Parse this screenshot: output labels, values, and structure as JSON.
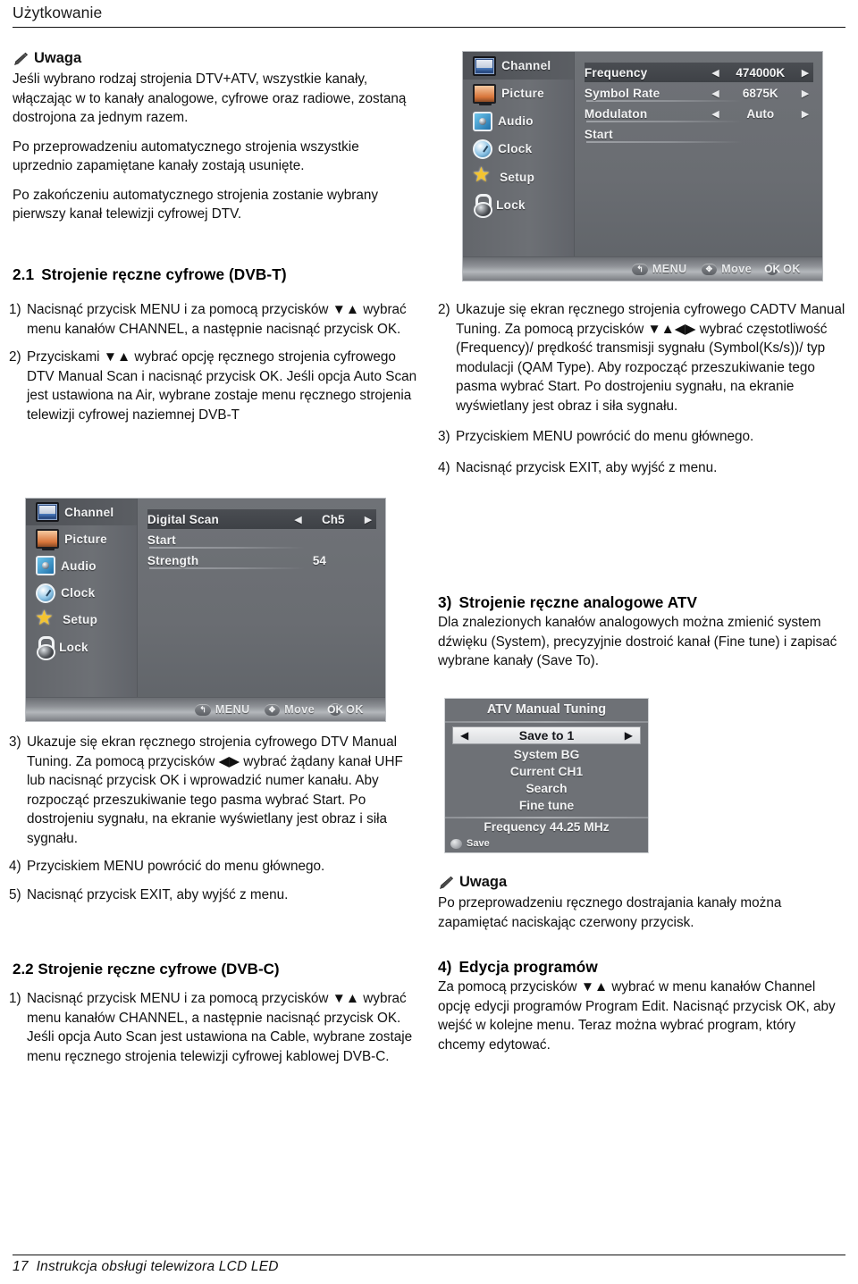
{
  "header": {
    "title": "Użytkowanie"
  },
  "footer": {
    "page": "17",
    "text": "Instrukcja obsługi telewizora LCD LED"
  },
  "note_top": {
    "heading": "Uwaga",
    "paragraphs": [
      "Jeśli wybrano rodzaj strojenia DTV+ATV, wszystkie kanały, włączając w to kanały analogowe, cyfrowe oraz radiowe, zostaną dostrojona za jednym razem.",
      "Po przeprowadzeniu automatycznego strojenia wszystkie uprzednio zapamiętane kanały zostają usunięte.",
      "Po zakończeniu automatycznego strojenia zostanie wybrany pierwszy kanał telewizji cyfrowej DTV."
    ]
  },
  "section_2_1": {
    "number": "2.1",
    "title": "Strojenie ręczne cyfrowe (DVB-T)",
    "steps": [
      {
        "marker": "1)",
        "text": "Nacisnąć przycisk MENU i za pomocą przycisków ▼▲ wybrać menu kanałów CHANNEL, a następnie nacisnąć przycisk OK."
      },
      {
        "marker": "2)",
        "text": "Przyciskami ▼▲ wybrać opcję ręcznego strojenia cyfrowego DTV Manual Scan i nacisnąć przycisk OK. Jeśli opcja Auto Scan  jest ustawiona na Air, wybrane zostaje menu ręcznego strojenia telewizji cyfrowej naziemnej DVB-T"
      }
    ],
    "steps_after_image": [
      {
        "marker": "3)",
        "text": "Ukazuje się ekran ręcznego strojenia cyfrowego DTV Manual Tuning.  Za pomocą przycisków ◀▶ wybrać żądany kanał UHF lub nacisnąć przycisk OK i wprowadzić numer kanału.  Aby rozpocząć przeszukiwanie tego pasma wybrać Start. Po dostrojeniu sygnału, na ekranie wyświetlany jest obraz i siła sygnału."
      },
      {
        "marker": "4)",
        "text": "Przyciskiem MENU powrócić do menu głównego."
      },
      {
        "marker": "5)",
        "text": "Nacisnąć przycisk EXIT, aby wyjść z menu."
      }
    ]
  },
  "section_2_2": {
    "number": "2.2",
    "title": "Strojenie ręczne cyfrowe (DVB-C)",
    "steps": [
      {
        "marker": "1)",
        "text": "Nacisnąć przycisk MENU i za pomocą przycisków ▼▲ wybrać menu kanałów CHANNEL, a następnie nacisnąć przycisk OK. Jeśli opcja Auto Scan jest ustawiona na Cable, wybrane zostaje menu ręcznego strojenia telewizji cyfrowej kablowej DVB-C."
      }
    ]
  },
  "right_steps_dvbc": [
    {
      "marker": "2)",
      "text": "Ukazuje się ekran ręcznego strojenia cyfrowego CADTV Manual Tuning. Za pomocą przycisków ▼▲◀▶ wybrać częstotliwość (Frequency)/ prędkość transmisji sygnału (Symbol(Ks/s))/ typ modulacji (QAM Type). Aby rozpocząć przeszukiwanie tego pasma wybrać Start. Po dostrojeniu sygnału, na ekranie wyświetlany jest obraz i siła sygnału."
    },
    {
      "marker": "3)",
      "text": "Przyciskiem MENU powrócić do menu głównego."
    },
    {
      "marker": "4)",
      "text": "Nacisnąć przycisk EXIT, aby wyjść z menu."
    }
  ],
  "section_3": {
    "number": "3)",
    "title": "Strojenie ręczne analogowe ATV",
    "body": "Dla znalezionych kanałów analogowych można zmienić system dźwięku (System), precyzyjnie dostroić kanał (Fine tune) i zapisać wybrane kanały (Save To)."
  },
  "note_bottom": {
    "heading": "Uwaga",
    "body": "Po przeprowadzeniu ręcznego dostrajania kanały można zapamiętać naciskając czerwony przycisk."
  },
  "section_4": {
    "number": "4)",
    "title": "Edycja programów",
    "body": "Za pomocą przycisków ▼▲ wybrać w menu kanałów Channel opcję edycji programów Program Edit. Nacisnąć przycisk OK, aby wejść w kolejne menu. Teraz można wybrać program, który chcemy edytować."
  },
  "osd_dvbc": {
    "sidebar": [
      {
        "label": "Channel",
        "icon": "channel-icon",
        "selected": true
      },
      {
        "label": "Picture",
        "icon": "picture-icon",
        "selected": false
      },
      {
        "label": "Audio",
        "icon": "audio-icon",
        "selected": false
      },
      {
        "label": "Clock",
        "icon": "clock-icon",
        "selected": false
      },
      {
        "label": "Setup",
        "icon": "setup-star-icon",
        "selected": false
      },
      {
        "label": "Lock",
        "icon": "lock-icon",
        "selected": false
      }
    ],
    "rows": [
      {
        "name": "Frequency",
        "value": "474000K",
        "spinner": true,
        "highlighted": true
      },
      {
        "name": "Symbol Rate",
        "value": "6875K",
        "spinner": true,
        "highlighted": false
      },
      {
        "name": "Modulaton",
        "value": "Auto",
        "spinner": true,
        "highlighted": false
      },
      {
        "name": "Start",
        "value": "",
        "spinner": false,
        "highlighted": false
      }
    ],
    "footer": [
      {
        "badge": "↰",
        "label": "MENU"
      },
      {
        "badge": "✥",
        "label": "Move"
      },
      {
        "badge": "OK",
        "label": "OK"
      }
    ]
  },
  "osd_dvbt": {
    "sidebar": [
      {
        "label": "Channel",
        "icon": "channel-icon",
        "selected": true
      },
      {
        "label": "Picture",
        "icon": "picture-icon",
        "selected": false
      },
      {
        "label": "Audio",
        "icon": "audio-icon",
        "selected": false
      },
      {
        "label": "Clock",
        "icon": "clock-icon",
        "selected": false
      },
      {
        "label": "Setup",
        "icon": "setup-star-icon",
        "selected": false
      },
      {
        "label": "Lock",
        "icon": "lock-icon",
        "selected": false
      }
    ],
    "rows": [
      {
        "name": "Digital Scan",
        "value": "Ch5",
        "spinner": true,
        "highlighted": true
      },
      {
        "name": "Start",
        "value": "",
        "spinner": false,
        "highlighted": false
      },
      {
        "name": "Strength",
        "value": "54",
        "spinner": false,
        "plain": true,
        "highlighted": false
      }
    ],
    "footer": [
      {
        "badge": "↰",
        "label": "MENU"
      },
      {
        "badge": "✥",
        "label": "Move"
      },
      {
        "badge": "OK",
        "label": "OK"
      }
    ]
  },
  "atv_box": {
    "title": "ATV Manual Tuning",
    "selected_row": {
      "left_arrow": "◀",
      "label": "Save to 1",
      "right_arrow": "▶"
    },
    "rows": [
      "System BG",
      "Current CH1",
      "Search",
      "Fine tune"
    ],
    "frequency": "Frequency 44.25 MHz",
    "save_label": "Save"
  },
  "colors": {
    "osd_bg": "#6e7176",
    "osd_highlight": "#44474c",
    "osd_text": "#f3f4f5",
    "page_text": "#111111"
  }
}
